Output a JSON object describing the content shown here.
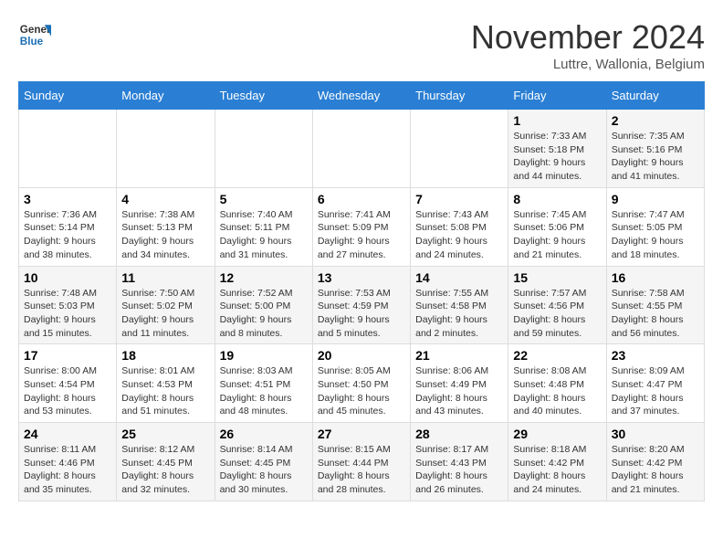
{
  "logo": {
    "line1": "General",
    "line2": "Blue"
  },
  "title": "November 2024",
  "subtitle": "Luttre, Wallonia, Belgium",
  "weekdays": [
    "Sunday",
    "Monday",
    "Tuesday",
    "Wednesday",
    "Thursday",
    "Friday",
    "Saturday"
  ],
  "weeks": [
    [
      null,
      null,
      null,
      null,
      null,
      {
        "day": "1",
        "sunrise": "Sunrise: 7:33 AM",
        "sunset": "Sunset: 5:18 PM",
        "daylight": "Daylight: 9 hours and 44 minutes."
      },
      {
        "day": "2",
        "sunrise": "Sunrise: 7:35 AM",
        "sunset": "Sunset: 5:16 PM",
        "daylight": "Daylight: 9 hours and 41 minutes."
      }
    ],
    [
      {
        "day": "3",
        "sunrise": "Sunrise: 7:36 AM",
        "sunset": "Sunset: 5:14 PM",
        "daylight": "Daylight: 9 hours and 38 minutes."
      },
      {
        "day": "4",
        "sunrise": "Sunrise: 7:38 AM",
        "sunset": "Sunset: 5:13 PM",
        "daylight": "Daylight: 9 hours and 34 minutes."
      },
      {
        "day": "5",
        "sunrise": "Sunrise: 7:40 AM",
        "sunset": "Sunset: 5:11 PM",
        "daylight": "Daylight: 9 hours and 31 minutes."
      },
      {
        "day": "6",
        "sunrise": "Sunrise: 7:41 AM",
        "sunset": "Sunset: 5:09 PM",
        "daylight": "Daylight: 9 hours and 27 minutes."
      },
      {
        "day": "7",
        "sunrise": "Sunrise: 7:43 AM",
        "sunset": "Sunset: 5:08 PM",
        "daylight": "Daylight: 9 hours and 24 minutes."
      },
      {
        "day": "8",
        "sunrise": "Sunrise: 7:45 AM",
        "sunset": "Sunset: 5:06 PM",
        "daylight": "Daylight: 9 hours and 21 minutes."
      },
      {
        "day": "9",
        "sunrise": "Sunrise: 7:47 AM",
        "sunset": "Sunset: 5:05 PM",
        "daylight": "Daylight: 9 hours and 18 minutes."
      }
    ],
    [
      {
        "day": "10",
        "sunrise": "Sunrise: 7:48 AM",
        "sunset": "Sunset: 5:03 PM",
        "daylight": "Daylight: 9 hours and 15 minutes."
      },
      {
        "day": "11",
        "sunrise": "Sunrise: 7:50 AM",
        "sunset": "Sunset: 5:02 PM",
        "daylight": "Daylight: 9 hours and 11 minutes."
      },
      {
        "day": "12",
        "sunrise": "Sunrise: 7:52 AM",
        "sunset": "Sunset: 5:00 PM",
        "daylight": "Daylight: 9 hours and 8 minutes."
      },
      {
        "day": "13",
        "sunrise": "Sunrise: 7:53 AM",
        "sunset": "Sunset: 4:59 PM",
        "daylight": "Daylight: 9 hours and 5 minutes."
      },
      {
        "day": "14",
        "sunrise": "Sunrise: 7:55 AM",
        "sunset": "Sunset: 4:58 PM",
        "daylight": "Daylight: 9 hours and 2 minutes."
      },
      {
        "day": "15",
        "sunrise": "Sunrise: 7:57 AM",
        "sunset": "Sunset: 4:56 PM",
        "daylight": "Daylight: 8 hours and 59 minutes."
      },
      {
        "day": "16",
        "sunrise": "Sunrise: 7:58 AM",
        "sunset": "Sunset: 4:55 PM",
        "daylight": "Daylight: 8 hours and 56 minutes."
      }
    ],
    [
      {
        "day": "17",
        "sunrise": "Sunrise: 8:00 AM",
        "sunset": "Sunset: 4:54 PM",
        "daylight": "Daylight: 8 hours and 53 minutes."
      },
      {
        "day": "18",
        "sunrise": "Sunrise: 8:01 AM",
        "sunset": "Sunset: 4:53 PM",
        "daylight": "Daylight: 8 hours and 51 minutes."
      },
      {
        "day": "19",
        "sunrise": "Sunrise: 8:03 AM",
        "sunset": "Sunset: 4:51 PM",
        "daylight": "Daylight: 8 hours and 48 minutes."
      },
      {
        "day": "20",
        "sunrise": "Sunrise: 8:05 AM",
        "sunset": "Sunset: 4:50 PM",
        "daylight": "Daylight: 8 hours and 45 minutes."
      },
      {
        "day": "21",
        "sunrise": "Sunrise: 8:06 AM",
        "sunset": "Sunset: 4:49 PM",
        "daylight": "Daylight: 8 hours and 43 minutes."
      },
      {
        "day": "22",
        "sunrise": "Sunrise: 8:08 AM",
        "sunset": "Sunset: 4:48 PM",
        "daylight": "Daylight: 8 hours and 40 minutes."
      },
      {
        "day": "23",
        "sunrise": "Sunrise: 8:09 AM",
        "sunset": "Sunset: 4:47 PM",
        "daylight": "Daylight: 8 hours and 37 minutes."
      }
    ],
    [
      {
        "day": "24",
        "sunrise": "Sunrise: 8:11 AM",
        "sunset": "Sunset: 4:46 PM",
        "daylight": "Daylight: 8 hours and 35 minutes."
      },
      {
        "day": "25",
        "sunrise": "Sunrise: 8:12 AM",
        "sunset": "Sunset: 4:45 PM",
        "daylight": "Daylight: 8 hours and 32 minutes."
      },
      {
        "day": "26",
        "sunrise": "Sunrise: 8:14 AM",
        "sunset": "Sunset: 4:45 PM",
        "daylight": "Daylight: 8 hours and 30 minutes."
      },
      {
        "day": "27",
        "sunrise": "Sunrise: 8:15 AM",
        "sunset": "Sunset: 4:44 PM",
        "daylight": "Daylight: 8 hours and 28 minutes."
      },
      {
        "day": "28",
        "sunrise": "Sunrise: 8:17 AM",
        "sunset": "Sunset: 4:43 PM",
        "daylight": "Daylight: 8 hours and 26 minutes."
      },
      {
        "day": "29",
        "sunrise": "Sunrise: 8:18 AM",
        "sunset": "Sunset: 4:42 PM",
        "daylight": "Daylight: 8 hours and 24 minutes."
      },
      {
        "day": "30",
        "sunrise": "Sunrise: 8:20 AM",
        "sunset": "Sunset: 4:42 PM",
        "daylight": "Daylight: 8 hours and 21 minutes."
      }
    ]
  ]
}
